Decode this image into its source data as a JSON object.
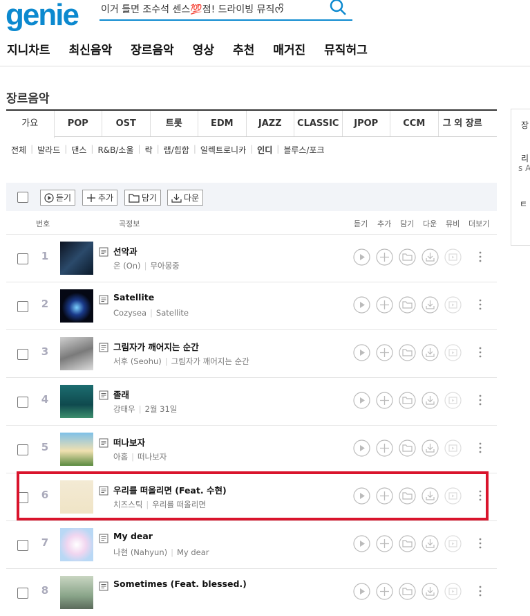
{
  "logo": "genie",
  "search": {
    "query": "이거 틀면 조수석 센스💯점! 드라이빙 뮤직ᰔᩚ"
  },
  "gnb": [
    "지니차트",
    "최신음악",
    "장르음악",
    "영상",
    "추천",
    "매거진",
    "뮤직허그"
  ],
  "page_title": "장르음악",
  "tabs": [
    "가요",
    "POP",
    "OST",
    "트롯",
    "EDM",
    "JAZZ",
    "CLASSIC",
    "JPOP",
    "CCM",
    "그 외 장르"
  ],
  "subgenres": [
    "전체",
    "발라드",
    "댄스",
    "R&B/소울",
    "락",
    "랩/힙합",
    "일렉트로니카",
    "인디",
    "블루스/포크"
  ],
  "toolbar": {
    "listen": "듣기",
    "add": "추가",
    "save": "담기",
    "download": "다운"
  },
  "columns": {
    "no": "번호",
    "info": "곡정보",
    "listen": "듣기",
    "add": "추가",
    "save": "담기",
    "down": "다운",
    "mv": "뮤비",
    "more": "더보기"
  },
  "songs": [
    {
      "rank": "1",
      "title": "선악과",
      "artist": "온 (On)",
      "album": "무아몽중"
    },
    {
      "rank": "2",
      "title": "Satellite",
      "artist": "Cozysea",
      "album": "Satellite"
    },
    {
      "rank": "3",
      "title": "그림자가 깨어지는 순간",
      "artist": "서후 (Seohu)",
      "album": "그림자가 깨어지는 순간"
    },
    {
      "rank": "4",
      "title": "졸래",
      "artist": "강태우",
      "album": "2월 31일"
    },
    {
      "rank": "5",
      "title": "떠나보자",
      "artist": "아홉",
      "album": "떠나보자"
    },
    {
      "rank": "6",
      "title": "우리를 떠올리면 (Feat. 수현)",
      "artist": "치즈스틱",
      "album": "우리를 떠올리면"
    },
    {
      "rank": "7",
      "title": "My dear",
      "artist": "나현 (Nahyun)",
      "album": "My dear"
    },
    {
      "rank": "8",
      "title": "Sometimes (Feat. blessed.)",
      "artist": "",
      "album": ""
    }
  ],
  "side": {
    "t1": "장",
    "t2": "리",
    "t3": "s A",
    "t4": "ㅌ ㅂ"
  },
  "colors": {
    "brand": "#0c89cf",
    "highlight": "#d9142c"
  }
}
